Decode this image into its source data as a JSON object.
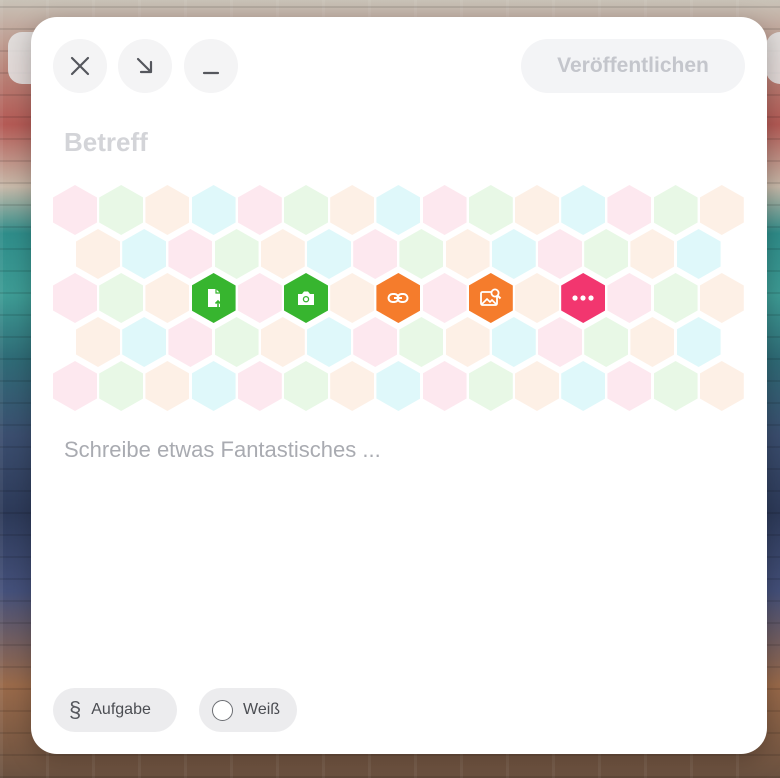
{
  "toolbar": {
    "close_icon": "close-icon",
    "expand_icon": "arrow-down-right-icon",
    "minimize_icon": "minimize-icon",
    "publish_label": "Veröffentlichen"
  },
  "subject": {
    "placeholder": "Betreff"
  },
  "attachments": [
    {
      "name": "upload-file",
      "icon": "file-upload-icon",
      "color": "#37b52f"
    },
    {
      "name": "camera",
      "icon": "camera-icon",
      "color": "#37b52f"
    },
    {
      "name": "link",
      "icon": "link-icon",
      "color": "#f57c2c"
    },
    {
      "name": "image-search",
      "icon": "image-search-icon",
      "color": "#f57c2c"
    },
    {
      "name": "more",
      "icon": "more-icon",
      "color": "#f2366f"
    }
  ],
  "body": {
    "placeholder": "Schreibe etwas Fantastisches ..."
  },
  "footer": {
    "task_label": "Aufgabe",
    "task_symbol": "§",
    "color_label": "Weiß"
  },
  "colors": {
    "hex_pink": "#fde8ef",
    "hex_green": "#e8f8e6",
    "hex_peach": "#fdf0e6",
    "hex_cyan": "#dff8fa"
  }
}
